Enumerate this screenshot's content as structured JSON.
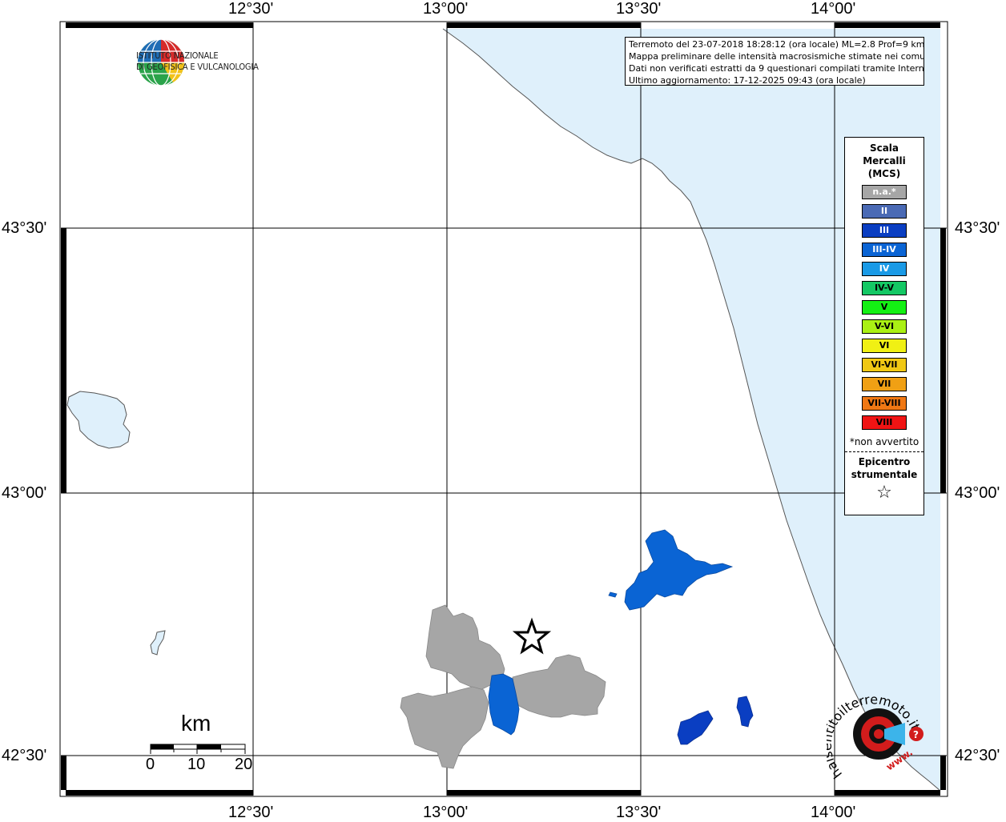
{
  "info_box": {
    "line1": "Terremoto del 23-07-2018 18:28:12 (ora locale) ML=2.8 Prof=9 km",
    "line2": "Mappa preliminare delle intensità macrosismiche stimate nei comuni",
    "line3": "Dati non verificati estratti da 9 questionari compilati tramite Internet.",
    "line4": "Ultimo aggiornamento: 17-12-2025 09:43 (ora locale)"
  },
  "axes": {
    "lon_ticks": [
      "12°30'",
      "13°00'",
      "13°30'",
      "14°00'"
    ],
    "lat_ticks": [
      "43°30'",
      "43°00'",
      "42°30'"
    ]
  },
  "logo": {
    "line1": "ISTITUTO NAZIONALE",
    "line2": "DI GEOFISICA E VULCANOLOGIA"
  },
  "legend": {
    "title_line1": "Scala",
    "title_line2": "Mercalli",
    "title_line3": "(MCS)",
    "classes": [
      {
        "label": "n.a.*",
        "color": "#a6a6a6"
      },
      {
        "label": "II",
        "color": "#4a6ab5"
      },
      {
        "label": "III",
        "color": "#0a3ec2"
      },
      {
        "label": "III-IV",
        "color": "#0a64d4"
      },
      {
        "label": "IV",
        "color": "#1a9ae6"
      },
      {
        "label": "IV-V",
        "color": "#14c864"
      },
      {
        "label": "V",
        "color": "#14f014"
      },
      {
        "label": "V-VI",
        "color": "#aaf014"
      },
      {
        "label": "VI",
        "color": "#f0f014"
      },
      {
        "label": "VI-VII",
        "color": "#f0c814"
      },
      {
        "label": "VII",
        "color": "#f0a014"
      },
      {
        "label": "VII-VIII",
        "color": "#f07814"
      },
      {
        "label": "VIII",
        "color": "#f01414"
      }
    ],
    "note": "*non avvertito",
    "epicenter_line1": "Epicentro",
    "epicenter_line2": "strumentale"
  },
  "scale_bar": {
    "unit": "km",
    "labels": [
      "0",
      "10",
      "20"
    ]
  },
  "hsit_logo": {
    "text": "haisentitoilterremoto.it",
    "url_text": "www."
  },
  "colors": {
    "sea": "#dff0fb",
    "na": "#a6a6a6",
    "iii": "#0a3ec2",
    "iii_iv": "#0a64d4"
  }
}
